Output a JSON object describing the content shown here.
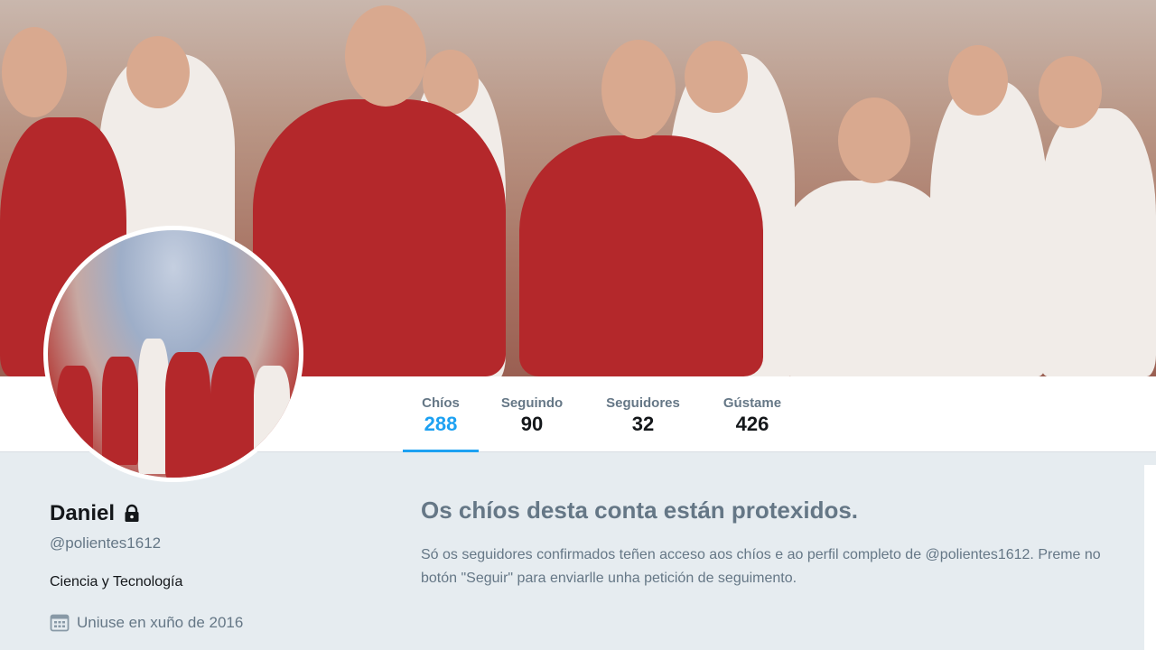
{
  "profile": {
    "name": "Daniel",
    "handle": "@polientes1612",
    "bio": "Ciencia y Tecnología",
    "joined": "Uniuse en xuño de 2016"
  },
  "stats": [
    {
      "label": "Chíos",
      "value": "288"
    },
    {
      "label": "Seguindo",
      "value": "90"
    },
    {
      "label": "Seguidores",
      "value": "32"
    },
    {
      "label": "Gústame",
      "value": "426"
    }
  ],
  "protected": {
    "title": "Os chíos desta conta están protexidos.",
    "text": "Só os seguidores confirmados teñen acceso aos chíos e ao perfil completo de @polientes1612. Preme no botón \"Seguir\" para enviarlle unha petición de seguimento."
  },
  "colors": {
    "accent": "#1da1f2",
    "muted": "#657786",
    "text": "#14171a",
    "background": "#e6ecf0"
  },
  "icons": {
    "lock": "lock-icon",
    "calendar": "calendar-icon"
  }
}
